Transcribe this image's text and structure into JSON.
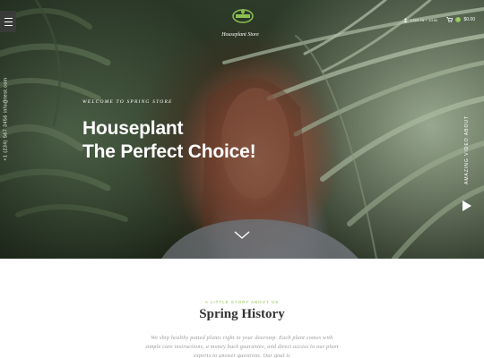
{
  "header": {
    "logo_text": "Houseplant Store",
    "login_label": "LOG IN / JOIN",
    "cart_count": "0",
    "cart_total": "$0.00"
  },
  "sidebar": {
    "contact": "+1 (234) 567 3456  info@test.com"
  },
  "hero": {
    "welcome": "WELCOME TO SPRING STORE",
    "headline_line1": "Houseplant",
    "headline_line2": "The Perfect Choice!",
    "video_label": "AMAZING VIDEO ABOUT"
  },
  "story": {
    "eyebrow": "A LITTLE STORY ABOUT US",
    "title": "Spring History",
    "text": "We ship healthy potted plants right to your doorstep. Each plant comes with simple care instructions, a money back guarantee, and direct access to our plant experts to answer questions. Our goal is"
  },
  "colors": {
    "accent": "#8cc152",
    "heading": "#333333",
    "body_text": "#9a9a9a"
  },
  "icons": {
    "menu": "hamburger-icon",
    "logo": "leaf-badge-icon",
    "login": "user-icon",
    "cart": "cart-icon",
    "play": "play-icon",
    "scroll": "chevron-down-icon"
  }
}
